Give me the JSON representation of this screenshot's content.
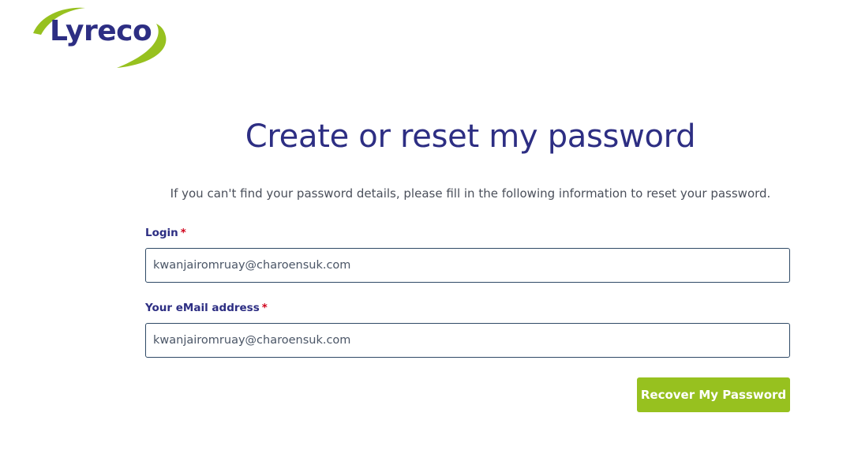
{
  "brand": {
    "logo_text": "Lyreco",
    "primary_color": "#2d2e83",
    "accent_color": "#97c11f"
  },
  "page": {
    "title": "Create or reset my password",
    "intro": "If you can't find your password details, please fill in the following information to reset your password."
  },
  "form": {
    "login": {
      "label": "Login",
      "required_mark": "*",
      "value": "kwanjairomruay@charoensuk.com"
    },
    "email": {
      "label": "Your eMail address",
      "required_mark": "*",
      "value": "kwanjairomruay@charoensuk.com"
    },
    "submit_label": "Recover My Password"
  }
}
